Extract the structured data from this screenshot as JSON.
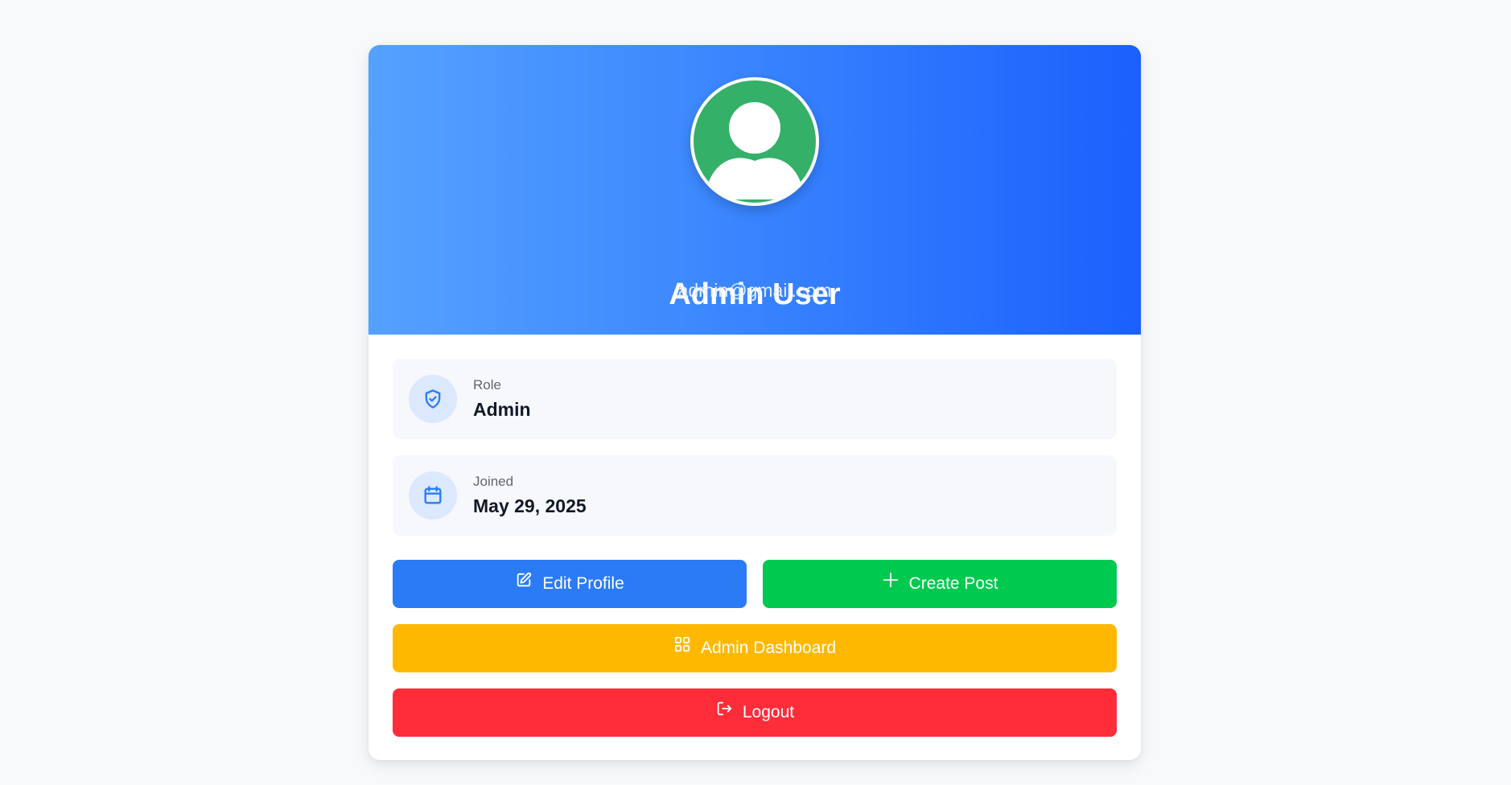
{
  "profile": {
    "name": "Admin User",
    "email": "admin@gmail.com",
    "avatar_icon": "user-avatar-icon"
  },
  "info": [
    {
      "icon": "shield-check-icon",
      "label": "Role",
      "value": "Admin"
    },
    {
      "icon": "calendar-icon",
      "label": "Joined",
      "value": "May 29, 2025"
    }
  ],
  "actions": {
    "edit_profile": {
      "label": "Edit Profile",
      "icon": "edit-icon",
      "color": "#2b7bf6"
    },
    "create_post": {
      "label": "Create Post",
      "icon": "plus-icon",
      "color": "#00c950"
    },
    "admin_dashboard": {
      "label": "Admin Dashboard",
      "icon": "dashboard-grid-icon",
      "color": "#ffb800"
    },
    "logout": {
      "label": "Logout",
      "icon": "logout-icon",
      "color": "#ff2c3a"
    }
  },
  "colors": {
    "header_gradient_start": "#55a1ff",
    "header_gradient_end": "#1b60fd",
    "avatar_bg": "#34b068",
    "icon_accent": "#2b7bf6"
  }
}
